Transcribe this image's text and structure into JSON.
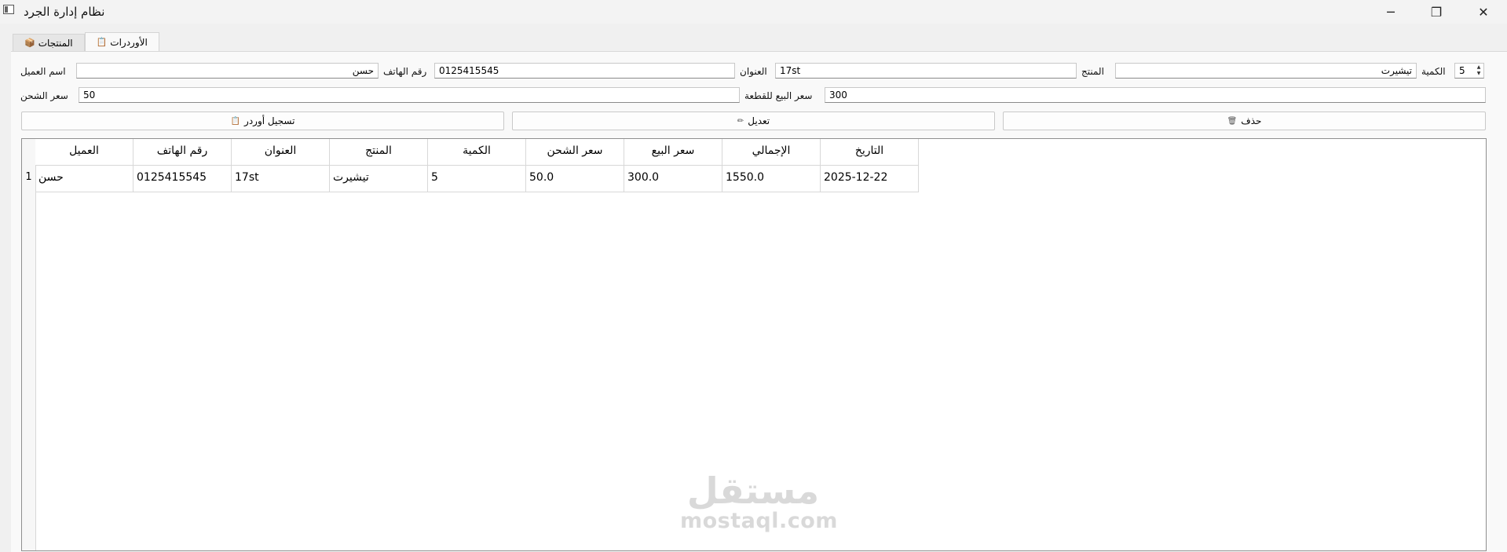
{
  "window": {
    "title": "نظام إدارة الجرد",
    "minimize_glyph": "─",
    "maximize_glyph": "❐",
    "close_glyph": "✕"
  },
  "tabs": [
    {
      "label": "المنتجات",
      "icon": "box-icon",
      "glyph": "📦",
      "active": false
    },
    {
      "label": "الأوردرات",
      "icon": "clipboard-icon",
      "glyph": "📋",
      "active": true
    }
  ],
  "form": {
    "customer_name": {
      "label": "اسم العميل",
      "value": "حسن"
    },
    "phone": {
      "label": "رقم الهاتف",
      "value": "0125415545"
    },
    "address": {
      "label": "العنوان",
      "value": "17st"
    },
    "product": {
      "label": "المنتج",
      "value": "تيشيرت"
    },
    "quantity": {
      "label": "الكمية",
      "value": "5",
      "up": "▲",
      "down": "▼"
    },
    "shipping_price": {
      "label": "سعر الشحن",
      "value": "50"
    },
    "unit_sale_price": {
      "label": "سعر البيع للقطعة",
      "value": "300"
    }
  },
  "buttons": {
    "register": {
      "label": "تسجيل أوردر",
      "icon": "clipboard-icon",
      "glyph": "📋"
    },
    "edit": {
      "label": "تعديل",
      "icon": "pencil-icon",
      "glyph": "✏"
    },
    "delete": {
      "label": "حذف",
      "icon": "trash-icon",
      "glyph": "🗑"
    }
  },
  "table": {
    "columns": [
      "العميل",
      "رقم الهاتف",
      "العنوان",
      "المنتج",
      "الكمية",
      "سعر الشحن",
      "سعر البيع",
      "الإجمالي",
      "التاريخ"
    ],
    "rows": [
      {
        "index": "1",
        "cells": [
          "حسن",
          "0125415545",
          "17st",
          "تيشيرت",
          "5",
          "50.0",
          "300.0",
          "1550.0",
          "2025-12-22"
        ]
      }
    ]
  },
  "watermark": {
    "arabic": "مستقل",
    "latin": "mostaql.com"
  }
}
